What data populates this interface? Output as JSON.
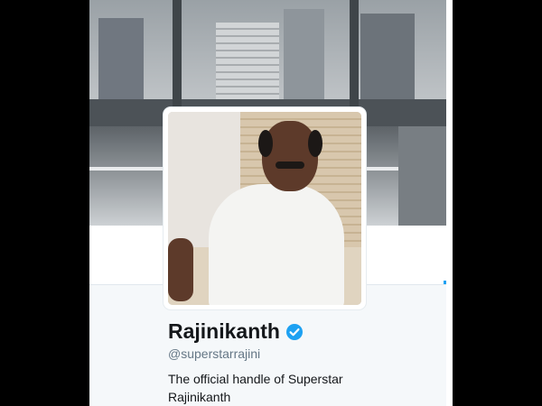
{
  "profile": {
    "name": "Rajinikanth",
    "handle": "@superstarrajini",
    "bio": "The official handle of Superstar Rajinikanth",
    "verified": true
  },
  "icons": {
    "verified": "verified-badge-icon"
  },
  "colors": {
    "verified_blue": "#1da1f2",
    "name_text": "#14171a",
    "handle_text": "#657786",
    "card_background": "#f5f8fa",
    "letterbox": "#000000"
  }
}
